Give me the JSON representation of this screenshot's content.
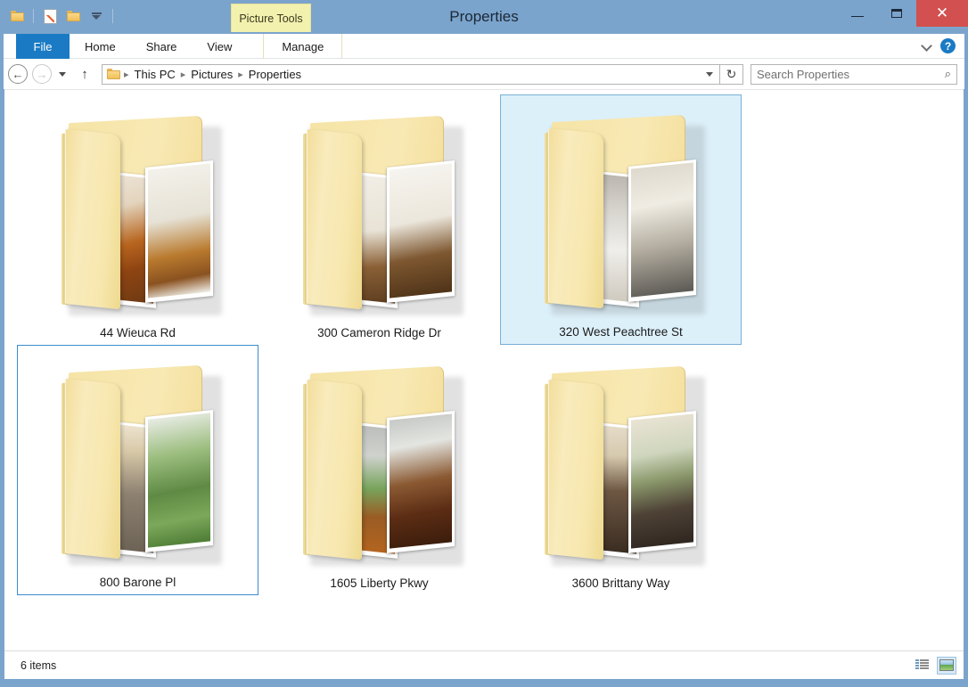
{
  "window": {
    "title": "Properties",
    "contextual_tab": "Picture Tools",
    "controls": {
      "minimize": "–",
      "maximize": "❐",
      "close": "✕"
    }
  },
  "quick_access": {
    "items": [
      {
        "name": "system-menu-folder-icon",
        "label": ""
      },
      {
        "name": "properties-icon",
        "label": ""
      },
      {
        "name": "new-folder-icon",
        "label": ""
      },
      {
        "name": "customize-qat-caret",
        "label": ""
      }
    ]
  },
  "ribbon": {
    "tabs": [
      {
        "label": "File",
        "state": "active-file"
      },
      {
        "label": "Home",
        "state": "normal"
      },
      {
        "label": "Share",
        "state": "normal"
      },
      {
        "label": "View",
        "state": "normal"
      },
      {
        "label": "Manage",
        "state": "contextual"
      }
    ],
    "expand_icon": "chevron-down-icon",
    "help_icon": "?"
  },
  "address_bar": {
    "back": "←",
    "forward": "→",
    "recent_caret": "",
    "up": "↑",
    "folder_icon": "folder-icon",
    "breadcrumbs": [
      "This PC",
      "Pictures",
      "Properties"
    ],
    "separator": "▸",
    "refresh": "↻"
  },
  "search": {
    "placeholder": "Search Properties",
    "value": "",
    "icon": "⌕"
  },
  "items": [
    {
      "name": "44 Wieuca Rd",
      "state": "normal",
      "photo_left": "kitchen-dining-interior",
      "photo_right": "white-kitchen-cabinets",
      "left_css": "linear-gradient(160deg,#efe8dd 0%,#e3d4bd 28%,#b8651f 55%,#8e4412 74%,#6d3a14 100%)",
      "right_css": "linear-gradient(175deg,#f3f1ea 0%,#e6e2d6 40%,#b97a2e 68%,#8a5220 86%,#f0efe8 100%)"
    },
    {
      "name": "300 Cameron Ridge Dr",
      "state": "normal",
      "photo_left": "hallway-with-console-table",
      "photo_right": "dining-room-window",
      "left_css": "linear-gradient(170deg,#f2efe7 0%,#e9e3d6 45%,#8a6036 72%,#5d3d20 100%)",
      "right_css": "linear-gradient(175deg,#f6f4ef 0%,#ece7dc 42%,#7d5730 70%,#4f3318 100%)"
    },
    {
      "name": "320 West Peachtree St",
      "state": "selected",
      "photo_left": "grey-wall-loft",
      "photo_right": "modern-bathroom-sink",
      "left_css": "linear-gradient(175deg,#b9b4ac 0%,#d8d5cf 30%,#efeeea 60%,#cfc9be 100%)",
      "right_css": "linear-gradient(175deg,#ded9cd 0%,#efece3 30%,#b4ada0 62%,#5c5a55 100%)"
    },
    {
      "name": "800 Barone Pl",
      "state": "focused",
      "photo_left": "porch-with-ceiling-fan",
      "photo_right": "front-yard-tree",
      "left_css": "linear-gradient(175deg,#efe6d2 0%,#d8c9a8 22%,#8d8171 55%,#6c6255 100%)",
      "right_css": "linear-gradient(175deg,#e8ece4 0%,#9bbd7e 30%,#5f8a44 58%,#7ba85a 80%,#4e7c35 100%)"
    },
    {
      "name": "1605 Liberty Pkwy",
      "state": "normal",
      "photo_left": "living-room-sliding-door",
      "photo_right": "cherry-wood-kitchen",
      "left_css": "linear-gradient(175deg,#b9bcb8 0%,#cfd2cd 25%,#78a45c 50%,#9a5c24 72%,#b4651f 100%)",
      "right_css": "linear-gradient(175deg,#c6c9c5 0%,#e3e5e1 22%,#8b5a33 50%,#5c2d14 74%,#3b1d0c 100%)"
    },
    {
      "name": "3600 Brittany Way",
      "state": "normal",
      "photo_left": "living-room-with-sofa",
      "photo_right": "window-blinds-couch",
      "left_css": "linear-gradient(175deg,#e6ddcb 0%,#d6c9ae 25%,#6d5743 52%,#3a2c21 100%)",
      "right_css": "linear-gradient(175deg,#e9e3d3 0%,#cfd6be 28%,#8c9a6d 48%,#4e4236 72%,#2f2620 100%)"
    }
  ],
  "status": {
    "item_count": "6 items",
    "views": [
      {
        "name": "details-view-button",
        "active": false
      },
      {
        "name": "large-icons-view-button",
        "active": true
      }
    ]
  }
}
